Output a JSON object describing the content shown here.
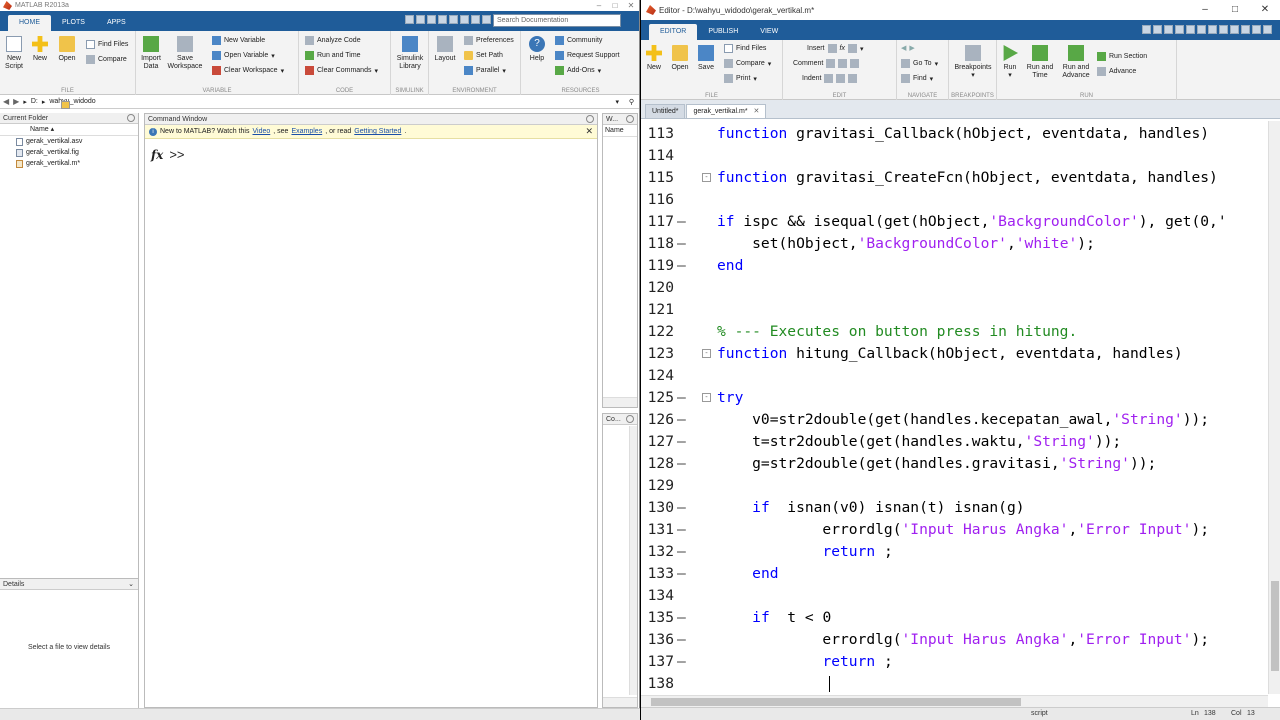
{
  "matlab": {
    "title": "MATLAB R2013a",
    "tabs": [
      "HOME",
      "PLOTS",
      "APPS"
    ],
    "search_placeholder": "Search Documentation",
    "ribbon": {
      "new_script": "New\nScript",
      "new": "New",
      "open": "Open",
      "find_files": "Find Files",
      "compare": "Compare",
      "import_data": "Import\nData",
      "save_workspace": "Save\nWorkspace",
      "new_variable": "New Variable",
      "open_variable": "Open Variable",
      "clear_workspace": "Clear Workspace",
      "analyze_code": "Analyze Code",
      "run_and_time": "Run and Time",
      "clear_commands": "Clear Commands",
      "simulink_library": "Simulink\nLibrary",
      "layout": "Layout",
      "preferences": "Preferences",
      "set_path": "Set Path",
      "parallel": "Parallel",
      "help": "Help",
      "community": "Community",
      "request_support": "Request Support",
      "add_ons": "Add-Ons",
      "groups": [
        "FILE",
        "VARIABLE",
        "CODE",
        "SIMULINK",
        "ENVIRONMENT",
        "RESOURCES"
      ]
    },
    "address": {
      "drive": "D:",
      "folder": "wahyu_widodo"
    },
    "current_folder": {
      "title": "Current Folder",
      "column": "Name",
      "files": [
        "gerak_vertikal.asv",
        "gerak_vertikal.fig",
        "gerak_vertikal.m*"
      ]
    },
    "details": {
      "title": "Details",
      "message": "Select a file to view details"
    },
    "command_window": {
      "title": "Command Window",
      "banner_prefix": "New to MATLAB? Watch this ",
      "banner_video": "Video",
      "banner_mid": ", see ",
      "banner_examples": "Examples",
      "banner_or": ", or read ",
      "banner_getting_started": "Getting Started",
      "banner_end": ".",
      "fx": "fx",
      "prompt": ">>"
    },
    "workspace": {
      "title": "W...",
      "column": "Name"
    },
    "history": {
      "title": "Co..."
    }
  },
  "editor": {
    "title": "Editor - D:\\wahyu_widodo\\gerak_vertikal.m*",
    "tabs": [
      "EDITOR",
      "PUBLISH",
      "VIEW"
    ],
    "ribbon": {
      "new": "New",
      "open": "Open",
      "save": "Save",
      "find_files": "Find Files",
      "compare": "Compare",
      "print": "Print",
      "insert": "Insert",
      "comment": "Comment",
      "indent": "Indent",
      "go_to": "Go To",
      "find": "Find",
      "breakpoints": "Breakpoints",
      "run": "Run",
      "run_and_time": "Run and\nTime",
      "run_and_advance": "Run and\nAdvance",
      "run_section": "Run Section",
      "advance": "Advance",
      "groups": [
        "FILE",
        "EDIT",
        "NAVIGATE",
        "BREAKPOINTS",
        "RUN"
      ]
    },
    "doc_tabs": [
      "Untitled*",
      "gerak_vertikal.m*"
    ],
    "code_lines": [
      {
        "n": "113",
        "dash": "",
        "fold": "",
        "segs": [
          [
            "kw",
            "function"
          ],
          [
            "",
            "gravitasi_Callback(hObject, eventdata, handles)"
          ]
        ]
      },
      {
        "n": "114",
        "dash": "",
        "fold": "",
        "segs": []
      },
      {
        "n": "115",
        "dash": "",
        "fold": "-",
        "segs": [
          [
            "kw",
            "function"
          ],
          [
            "",
            "gravitasi_CreateFcn(hObject, eventdata, handles)"
          ]
        ]
      },
      {
        "n": "116",
        "dash": "",
        "fold": "",
        "segs": []
      },
      {
        "n": "117",
        "dash": "-",
        "fold": "",
        "segs": [
          [
            "kw",
            "if"
          ],
          [
            "",
            "ispc && isequal(get(hObject,"
          ],
          [
            "str",
            "'BackgroundColor'"
          ],
          [
            "",
            "), get(0,'"
          ]
        ]
      },
      {
        "n": "118",
        "dash": "-",
        "fold": "",
        "segs": [
          [
            "",
            "    set(hObject,"
          ],
          [
            "str",
            "'BackgroundColor'"
          ],
          [
            "",
            ","
          ],
          [
            "str",
            "'white'"
          ],
          [
            "",
            ");"
          ]
        ]
      },
      {
        "n": "119",
        "dash": "-",
        "fold": "",
        "segs": [
          [
            "kw",
            "end"
          ]
        ]
      },
      {
        "n": "120",
        "dash": "",
        "fold": "",
        "segs": []
      },
      {
        "n": "121",
        "dash": "",
        "fold": "",
        "segs": []
      },
      {
        "n": "122",
        "dash": "",
        "fold": "",
        "segs": [
          [
            "cmt",
            "% --- Executes on button press in hitung."
          ]
        ]
      },
      {
        "n": "123",
        "dash": "",
        "fold": "-",
        "segs": [
          [
            "kw",
            "function"
          ],
          [
            "",
            "hitung_Callback(hObject, eventdata, handles)"
          ]
        ]
      },
      {
        "n": "124",
        "dash": "",
        "fold": "",
        "segs": []
      },
      {
        "n": "125",
        "dash": "-",
        "fold": "-",
        "segs": [
          [
            "kw",
            "try"
          ]
        ]
      },
      {
        "n": "126",
        "dash": "-",
        "fold": "",
        "segs": [
          [
            "",
            "    v0=str2double(get(handles.kecepatan_awal,"
          ],
          [
            "str",
            "'String'"
          ],
          [
            "",
            "));"
          ]
        ]
      },
      {
        "n": "127",
        "dash": "-",
        "fold": "",
        "segs": [
          [
            "",
            "    t=str2double(get(handles.waktu,"
          ],
          [
            "str",
            "'String'"
          ],
          [
            "",
            "));"
          ]
        ]
      },
      {
        "n": "128",
        "dash": "-",
        "fold": "",
        "segs": [
          [
            "",
            "    g=str2double(get(handles.gravitasi,"
          ],
          [
            "str",
            "'String'"
          ],
          [
            "",
            "));"
          ]
        ]
      },
      {
        "n": "129",
        "dash": "",
        "fold": "",
        "segs": []
      },
      {
        "n": "130",
        "dash": "-",
        "fold": "",
        "segs": [
          [
            "",
            "    "
          ],
          [
            "kw",
            "if"
          ],
          [
            "",
            " isnan(v0) isnan(t) isnan(g)"
          ]
        ]
      },
      {
        "n": "131",
        "dash": "-",
        "fold": "",
        "segs": [
          [
            "",
            "            errordlg("
          ],
          [
            "str",
            "'Input Harus Angka'"
          ],
          [
            "",
            ","
          ],
          [
            "str",
            "'Error Input'"
          ],
          [
            "",
            ");"
          ]
        ]
      },
      {
        "n": "132",
        "dash": "-",
        "fold": "",
        "segs": [
          [
            "",
            "            "
          ],
          [
            "kw",
            "return"
          ],
          [
            "",
            ";"
          ]
        ]
      },
      {
        "n": "133",
        "dash": "-",
        "fold": "",
        "segs": [
          [
            "",
            "    "
          ],
          [
            "kw",
            "end"
          ]
        ]
      },
      {
        "n": "134",
        "dash": "",
        "fold": "",
        "segs": []
      },
      {
        "n": "135",
        "dash": "-",
        "fold": "",
        "segs": [
          [
            "",
            "    "
          ],
          [
            "kw",
            "if"
          ],
          [
            "",
            " t < 0"
          ]
        ]
      },
      {
        "n": "136",
        "dash": "-",
        "fold": "",
        "segs": [
          [
            "",
            "            errordlg("
          ],
          [
            "str",
            "'Input Harus Angka'"
          ],
          [
            "",
            ","
          ],
          [
            "str",
            "'Error Input'"
          ],
          [
            "",
            ");"
          ]
        ]
      },
      {
        "n": "137",
        "dash": "-",
        "fold": "",
        "segs": [
          [
            "",
            "            "
          ],
          [
            "kw",
            "return"
          ],
          [
            "",
            ";"
          ]
        ]
      },
      {
        "n": "138",
        "dash": "",
        "fold": "",
        "segs": []
      }
    ],
    "status": {
      "mode": "script",
      "ln_label": "Ln",
      "ln": "138",
      "col_label": "Col",
      "col": "13"
    }
  }
}
